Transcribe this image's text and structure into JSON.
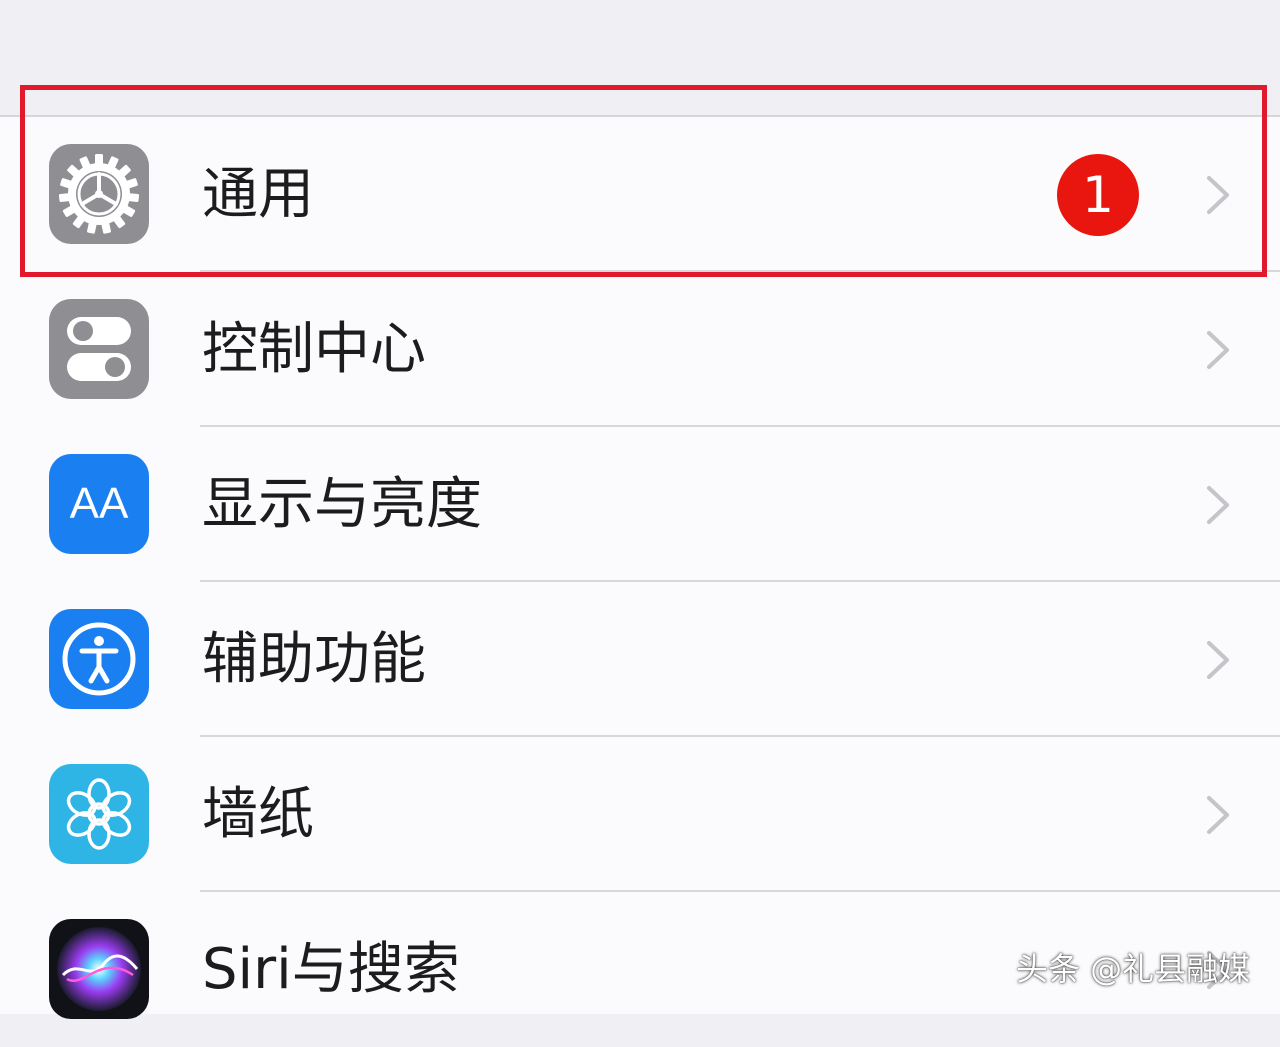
{
  "settings": {
    "rows": [
      {
        "label": "通用",
        "icon": "gear-icon",
        "icon_color": "#8e8e93",
        "badge": "1"
      },
      {
        "label": "控制中心",
        "icon": "toggle-switches-icon",
        "icon_color": "#8e8e93"
      },
      {
        "label": "显示与亮度",
        "icon": "text-size-aa-icon",
        "icon_color": "#1a7ff0",
        "icon_text": "AA"
      },
      {
        "label": "辅助功能",
        "icon": "accessibility-icon",
        "icon_color": "#1a7ff0"
      },
      {
        "label": "墙纸",
        "icon": "flower-icon",
        "icon_color": "#2fb4e6"
      },
      {
        "label": "Siri与搜索",
        "icon": "siri-icon",
        "icon_color": "#1b1b2e"
      }
    ]
  },
  "colors": {
    "highlight_frame": "#e01a2c",
    "badge": "#e8160e",
    "group_background": "#efeff4",
    "row_background": "#fbfbfd"
  },
  "watermark": {
    "text": "头条 @礼县融媒"
  }
}
